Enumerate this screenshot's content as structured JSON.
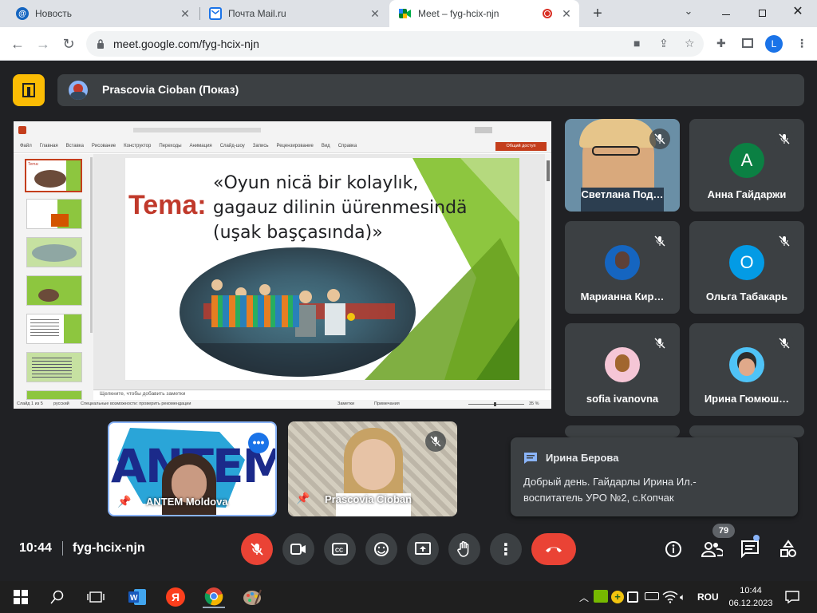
{
  "browser": {
    "tabs": [
      {
        "title": "Новость"
      },
      {
        "title": "Почта Mail.ru"
      },
      {
        "title": "Meet – fyg-hcix-njn"
      }
    ],
    "new_tab": "+",
    "url": "meet.google.com/fyg-hcix-njn",
    "profile_initial": "L"
  },
  "meet": {
    "presenter_label": "Prascovia Cioban (Показ)",
    "slide": {
      "menu": [
        "Файл",
        "Главная",
        "Вставка",
        "Рисование",
        "Конструктор",
        "Переходы",
        "Анимация",
        "Слайд-шоу",
        "Запись",
        "Рецензирование",
        "Вид",
        "Справка"
      ],
      "share_btn": "Общий доступ",
      "tema": "Tema:",
      "title_lines": [
        "«Oyun nicä bir kolaylık,",
        "gagauz dilinin üürenmesindä",
        "(uşak başçasında)»"
      ],
      "notes_hint": "Щелкните, чтобы добавить заметки",
      "status": "Слайд 1 из 5",
      "lang": "русский",
      "accessibility": "Специальные возможности: проверить рекомендации",
      "notes_btn": "Заметки",
      "comments_btn": "Примечания",
      "zoom": "35 %",
      "thumb_label": "Tema:"
    },
    "participants": [
      {
        "name": "Светлана Под…"
      },
      {
        "name": "Анна Гайдаржи",
        "initial": "A"
      },
      {
        "name": "Марианна Кир…"
      },
      {
        "name": "Ольга Табакарь",
        "initial": "O"
      },
      {
        "name": "sofia ivanovna"
      },
      {
        "name": "Ирина Гюмюш…"
      }
    ],
    "bottom_tiles": [
      {
        "name": "ANTEM Moldova",
        "logo": "ANTEM"
      },
      {
        "name": "Prascovia Cioban"
      }
    ],
    "chat_toast": {
      "sender": "Ирина Берова",
      "message_lines": [
        "Добрый день. Гайдарлы Ирина Ил.-",
        "воспитатель УРО №2, с.Копчак"
      ]
    },
    "time": "10:44",
    "meeting_code": "fyg-hcix-njn",
    "participant_count": "79"
  },
  "taskbar": {
    "lang": "ROU",
    "time": "10:44",
    "date": "06.12.2023"
  },
  "colors": {
    "meet_bg": "#202124",
    "tile_bg": "#3c4043",
    "end_call": "#ea4335",
    "presenter_logo": "#fbbc04",
    "tema_red": "#c0392b",
    "slide_green": "#8dc63f",
    "avatar_a": "#0b8043",
    "avatar_o": "#039be5"
  }
}
